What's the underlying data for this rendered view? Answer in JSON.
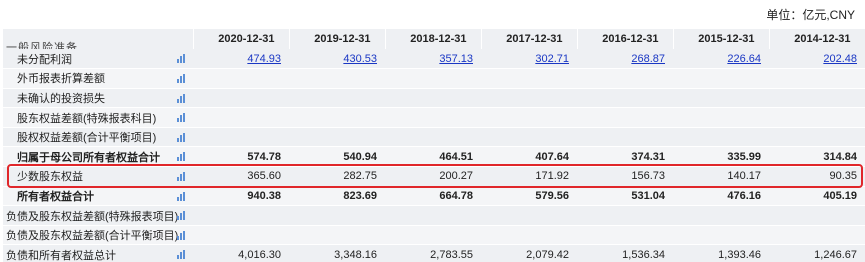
{
  "unit_label": "单位：亿元,CNY",
  "header": {
    "clipped_label": "一般风险准备",
    "years": [
      "2020-12-31",
      "2019-12-31",
      "2018-12-31",
      "2017-12-31",
      "2016-12-31",
      "2015-12-31",
      "2014-12-31"
    ]
  },
  "rows": [
    {
      "label": "未分配利润",
      "values": [
        "474.93",
        "430.53",
        "357.13",
        "302.71",
        "268.87",
        "226.64",
        "202.48"
      ]
    },
    {
      "label": "外币报表折算差额",
      "values": [
        "",
        "",
        "",
        "",
        "",
        "",
        ""
      ]
    },
    {
      "label": "未确认的投资损失",
      "values": [
        "",
        "",
        "",
        "",
        "",
        "",
        ""
      ]
    },
    {
      "label": "股东权益差额(特殊报表科目)",
      "values": [
        "",
        "",
        "",
        "",
        "",
        "",
        ""
      ]
    },
    {
      "label": "股权权益差额(合计平衡项目)",
      "values": [
        "",
        "",
        "",
        "",
        "",
        "",
        ""
      ]
    },
    {
      "label": "归属于母公司所有者权益合计",
      "values": [
        "574.78",
        "540.94",
        "464.51",
        "407.64",
        "374.31",
        "335.99",
        "314.84"
      ]
    },
    {
      "label": "少数股东权益",
      "values": [
        "365.60",
        "282.75",
        "200.27",
        "171.92",
        "156.73",
        "140.17",
        "90.35"
      ]
    },
    {
      "label": "所有者权益合计",
      "values": [
        "940.38",
        "823.69",
        "664.78",
        "579.56",
        "531.04",
        "476.16",
        "405.19"
      ]
    },
    {
      "label": "负债及股东权益差额(特殊报表项目)",
      "values": [
        "",
        "",
        "",
        "",
        "",
        "",
        ""
      ]
    },
    {
      "label": "负债及股东权益差额(合计平衡项目)",
      "values": [
        "",
        "",
        "",
        "",
        "",
        "",
        ""
      ]
    },
    {
      "label": "负债和所有者权益总计",
      "values": [
        "4,016.30",
        "3,348.16",
        "2,783.55",
        "2,079.42",
        "1,536.34",
        "1,393.46",
        "1,246.67"
      ]
    }
  ],
  "colors": {
    "link": "#1a37c4",
    "highlight_border": "#e0262a",
    "row_bg": "#eef0f3",
    "icon": "#5b8fd6"
  }
}
